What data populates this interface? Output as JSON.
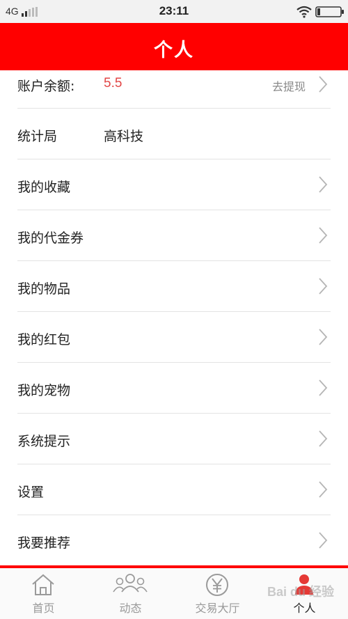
{
  "status_bar": {
    "network": "4G",
    "time": "23:11"
  },
  "header": {
    "title": "个人"
  },
  "balance_row": {
    "label": "账户余额:",
    "value": "5.5",
    "action": "去提现"
  },
  "info_row": {
    "label": "统计局",
    "value": "高科技"
  },
  "menu_items": [
    {
      "label": "我的收藏"
    },
    {
      "label": "我的代金券"
    },
    {
      "label": "我的物品"
    },
    {
      "label": "我的红包"
    },
    {
      "label": "我的宠物"
    },
    {
      "label": "系统提示"
    },
    {
      "label": "设置"
    },
    {
      "label": "我要推荐"
    }
  ],
  "tabbar": {
    "tabs": [
      {
        "label": "首页",
        "icon": "home-icon"
      },
      {
        "label": "动态",
        "icon": "people-icon"
      },
      {
        "label": "交易大厅",
        "icon": "yen-icon"
      },
      {
        "label": "个人",
        "icon": "user-icon"
      }
    ],
    "active_index": 3
  },
  "watermark": "Bai du 经验",
  "colors": {
    "accent": "#ff0000",
    "balance_value": "#e24646",
    "tab_inactive": "#999999"
  }
}
